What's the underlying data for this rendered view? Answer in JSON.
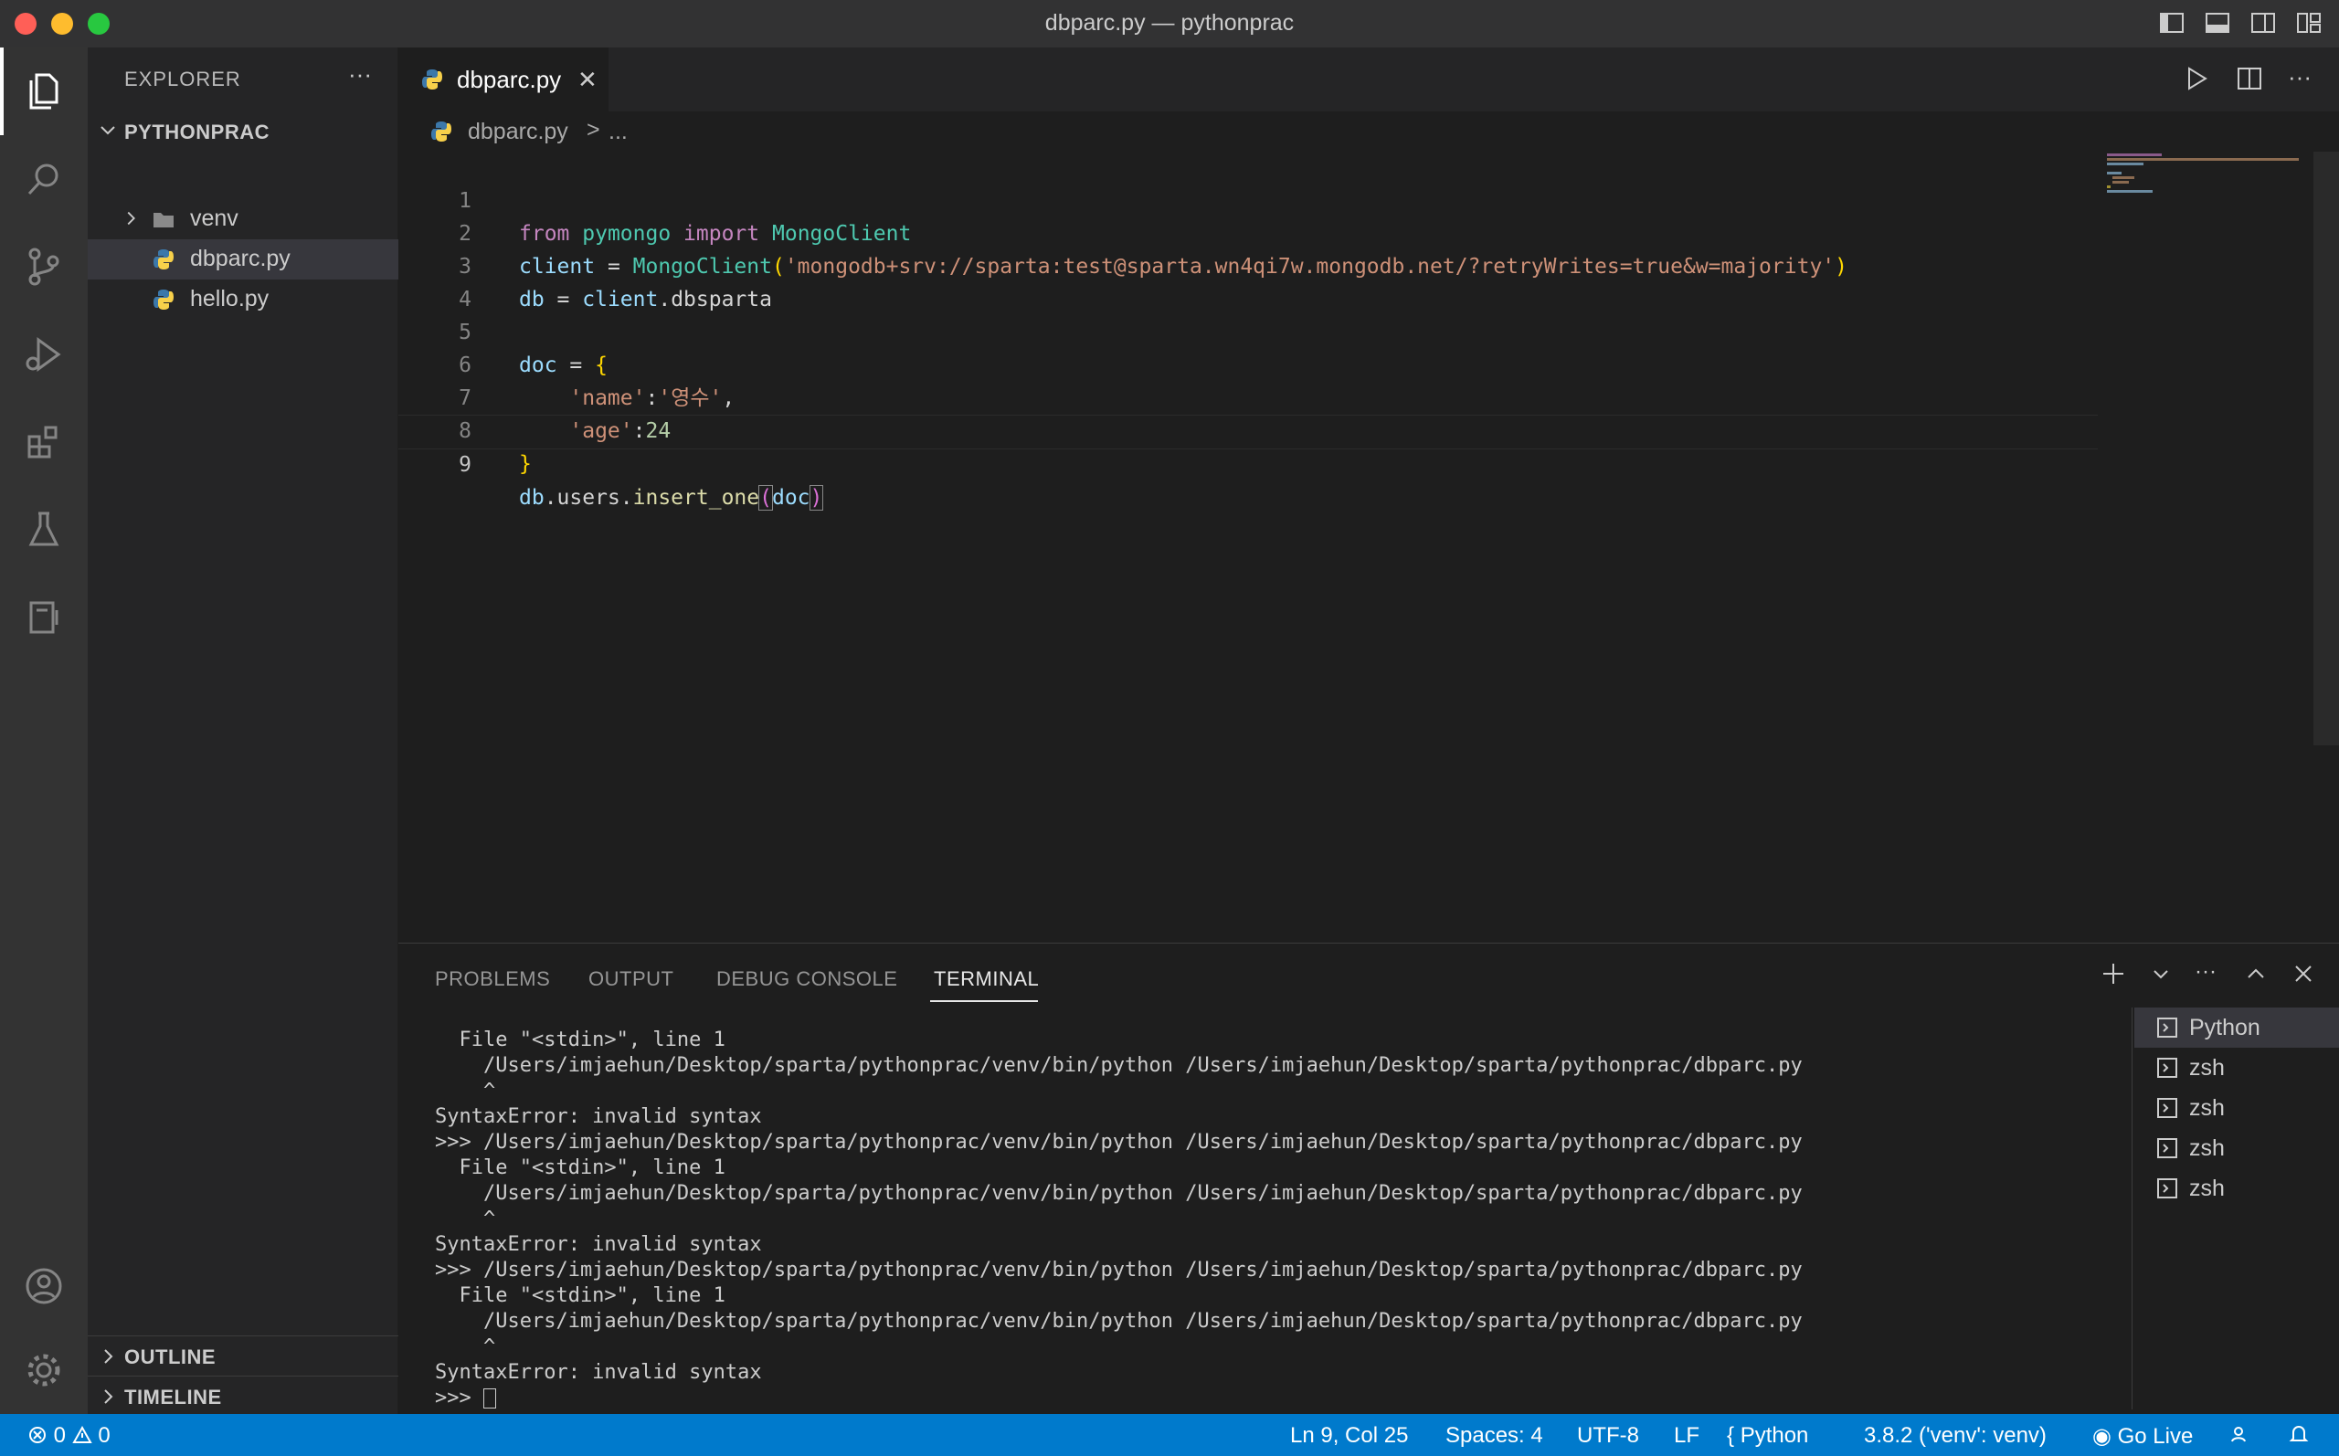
{
  "window": {
    "title": "dbparc.py — pythonprac"
  },
  "explorer": {
    "header": "EXPLORER",
    "project": "PYTHONPRAC",
    "items": [
      {
        "label": "venv",
        "type": "folder"
      },
      {
        "label": "dbparc.py",
        "type": "python"
      },
      {
        "label": "hello.py",
        "type": "python"
      }
    ],
    "outline": "OUTLINE",
    "timeline": "TIMELINE"
  },
  "tab": {
    "label": "dbparc.py"
  },
  "breadcrumb": {
    "file": "dbparc.py",
    "sep": ">",
    "more": "..."
  },
  "code": {
    "line_numbers": [
      "1",
      "2",
      "3",
      "4",
      "5",
      "6",
      "7",
      "8",
      "9"
    ],
    "l1": {
      "kw1": "from",
      "mod": "pymongo",
      "kw2": "import",
      "cls": "MongoClient"
    },
    "l2": {
      "var": "client",
      "op": " = ",
      "cls": "MongoClient",
      "str": "'mongodb+srv://sparta:test@sparta.wn4qi7w.mongodb.net/?retryWrites=true&w=majority'"
    },
    "l3": {
      "var": "db",
      "op": " = ",
      "obj": "client",
      "attr": ".dbsparta"
    },
    "l5": {
      "var": "doc",
      "op": " = ",
      "brace": "{"
    },
    "l6": {
      "key": "'name'",
      "colon": ":",
      "val": "'영수'",
      "comma": ","
    },
    "l7": {
      "key": "'age'",
      "colon": ":",
      "val": "24"
    },
    "l8": {
      "brace": "}"
    },
    "l9": {
      "obj": "db",
      "attr": ".users.",
      "fn": "insert_one",
      "arg": "doc"
    }
  },
  "panel": {
    "tabs": [
      "PROBLEMS",
      "OUTPUT",
      "DEBUG CONSOLE",
      "TERMINAL"
    ],
    "terminal_lines": [
      "  File \"<stdin>\", line 1",
      "    /Users/imjaehun/Desktop/sparta/pythonprac/venv/bin/python /Users/imjaehun/Desktop/sparta/pythonprac/dbparc.py",
      "    ^",
      "SyntaxError: invalid syntax",
      ">>> /Users/imjaehun/Desktop/sparta/pythonprac/venv/bin/python /Users/imjaehun/Desktop/sparta/pythonprac/dbparc.py",
      "  File \"<stdin>\", line 1",
      "    /Users/imjaehun/Desktop/sparta/pythonprac/venv/bin/python /Users/imjaehun/Desktop/sparta/pythonprac/dbparc.py",
      "    ^",
      "SyntaxError: invalid syntax",
      ">>> /Users/imjaehun/Desktop/sparta/pythonprac/venv/bin/python /Users/imjaehun/Desktop/sparta/pythonprac/dbparc.py",
      "  File \"<stdin>\", line 1",
      "    /Users/imjaehun/Desktop/sparta/pythonprac/venv/bin/python /Users/imjaehun/Desktop/sparta/pythonprac/dbparc.py",
      "    ^",
      "SyntaxError: invalid syntax"
    ],
    "prompt": ">>> ",
    "terminals": [
      "Python",
      "zsh",
      "zsh",
      "zsh",
      "zsh"
    ]
  },
  "status": {
    "errors": "0",
    "warnings": "0",
    "position": "Ln 9, Col 25",
    "spaces": "Spaces: 4",
    "encoding": "UTF-8",
    "eol": "LF",
    "language": "Python",
    "interpreter": "3.8.2 ('venv': venv)",
    "golive": "Go Live"
  },
  "colors": {
    "accent": "#007acc",
    "activity_bar": "#333333",
    "sidebar": "#252526",
    "editor": "#1e1e1e"
  }
}
